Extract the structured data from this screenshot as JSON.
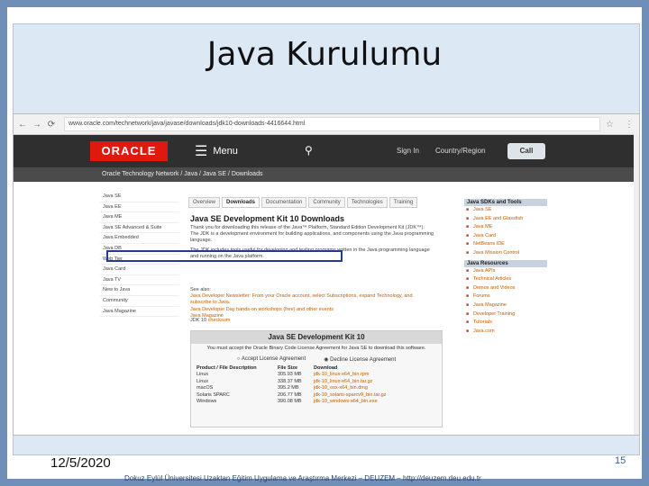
{
  "slide": {
    "title": "Java Kurulumu",
    "date": "12/5/2020",
    "page_number": "15",
    "footer": "Dokuz Eylül Üniversitesi Uzaktan Eğitim Uygulama ve Araştırma Merkezi – DEUZEM – http://deuzem.deu.edu.tr"
  },
  "browser": {
    "url": "www.oracle.com/technetwork/java/javase/downloads/jdk10-downloads-4416644.html",
    "logo": "ORACLE",
    "menu_label": "Menu",
    "signin": "Sign In",
    "country": "Country/Region",
    "call": "Call",
    "breadcrumb": "Oracle Technology Network  /  Java  /  Java SE  /  Downloads"
  },
  "leftnav": [
    "Java SE",
    "Java EE",
    "Java ME",
    "Java SE Advanced & Suite",
    "Java Embedded",
    "Java DB",
    "Web Tier",
    "Java Card",
    "Java TV",
    "New to Java",
    "Community",
    "Java Magazine"
  ],
  "tabs": [
    "Overview",
    "Downloads",
    "Documentation",
    "Community",
    "Technologies",
    "Training"
  ],
  "main": {
    "heading": "Java SE Development Kit 10 Downloads",
    "para1": "Thank you for downloading this release of the Java™ Platform, Standard Edition Development Kit (JDK™). The JDK is a development environment for building applications, and components using the Java programming language.",
    "para2": "The JDK includes tools useful for developing and testing programs written in the Java programming language and running on the Java platform.",
    "see_also": "See also:",
    "see1": "Java Developer Newsletter: From your Oracle account, select Subscriptions, expand Technology, and subscribe to Java.",
    "see2": "Java Developer Day hands-on workshops (free) and other events",
    "see3": "Java Magazine",
    "jdk_prefix": "JDK 10",
    "jdk_link": "checksum"
  },
  "download_box": {
    "title": "Java SE Development Kit 10",
    "note": "You must accept the Oracle Binary Code License Agreement for Java SE to download this software.",
    "accept": "Accept License Agreement",
    "decline": "Decline License Agreement",
    "headers": [
      "Product / File Description",
      "File Size",
      "Download"
    ],
    "rows": [
      {
        "os": "Linux",
        "size": "305.93 MB",
        "file": "jdk-10_linux-x64_bin.rpm"
      },
      {
        "os": "Linux",
        "size": "338.37 MB",
        "file": "jdk-10_linux-x64_bin.tar.gz"
      },
      {
        "os": "macOS",
        "size": "395.2 MB",
        "file": "jdk-10_osx-x64_bin.dmg"
      },
      {
        "os": "Solaris SPARC",
        "size": "206.77 MB",
        "file": "jdk-10_solaris-sparcv9_bin.tar.gz"
      },
      {
        "os": "Windows",
        "size": "390.08 MB",
        "file": "jdk-10_windows-x64_bin.exe"
      }
    ]
  },
  "rightcol": {
    "head1": "Java SDKs and Tools",
    "items1": [
      "Java SE",
      "Java EE and Glassfish",
      "Java ME",
      "Java Card",
      "NetBeans IDE",
      "Java Mission Control"
    ],
    "head2": "Java Resources",
    "items2": [
      "Java APIs",
      "Technical Articles",
      "Demos and Videos",
      "Forums",
      "Java Magazine",
      "Developer Training",
      "Tutorials",
      "Java.com"
    ]
  },
  "colors": {
    "oracle_red": "#e0190f",
    "highlight": "#1f3e8c",
    "slide_bg": "#dde8f5"
  }
}
